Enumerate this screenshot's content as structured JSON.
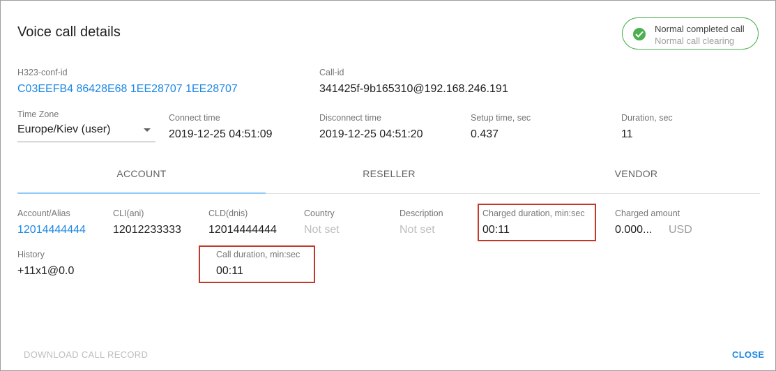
{
  "dialog": {
    "title": "Voice call details",
    "status": {
      "label": "Normal completed call",
      "reason": "Normal call clearing",
      "icon": "check-circle-icon",
      "color": "#4caf50"
    }
  },
  "ids": {
    "h323_conf_id_label": "H323-conf-id",
    "h323_conf_id_value": "C03EEFB4 86428E68 1EE28707 1EE28707",
    "call_id_label": "Call-id",
    "call_id_value": "341425f-9b165310@192.168.246.191"
  },
  "times": {
    "timezone_label": "Time Zone",
    "timezone_value": "Europe/Kiev (user)",
    "connect_label": "Connect time",
    "connect_value": "2019-12-25 04:51:09",
    "disconnect_label": "Disconnect time",
    "disconnect_value": "2019-12-25 04:51:20",
    "setup_label": "Setup time, sec",
    "setup_value": "0.437",
    "duration_label": "Duration, sec",
    "duration_value": "11"
  },
  "tabs": [
    {
      "label": "ACCOUNT",
      "active": true
    },
    {
      "label": "RESELLER",
      "active": false
    },
    {
      "label": "VENDOR",
      "active": false
    }
  ],
  "account": {
    "alias_label": "Account/Alias",
    "alias_value": "12014444444",
    "cli_label": "CLI(ani)",
    "cli_value": "12012233333",
    "cld_label": "CLD(dnis)",
    "cld_value": "12014444444",
    "country_label": "Country",
    "country_value": "Not set",
    "description_label": "Description",
    "description_value": "Not set",
    "charged_duration_label": "Charged duration, min:sec",
    "charged_duration_value": "00:11",
    "charged_amount_label": "Charged amount",
    "charged_amount_value": "0.000...",
    "charged_amount_currency": "USD",
    "history_label": "History",
    "history_value": "+11x1@0.0",
    "call_duration_label": "Call duration, min:sec",
    "call_duration_value": "00:11"
  },
  "footer": {
    "download_label": "DOWNLOAD CALL RECORD",
    "close_label": "CLOSE"
  },
  "colors": {
    "accent": "#1e88e5",
    "highlight_border": "#c0392b",
    "success": "#4caf50"
  }
}
